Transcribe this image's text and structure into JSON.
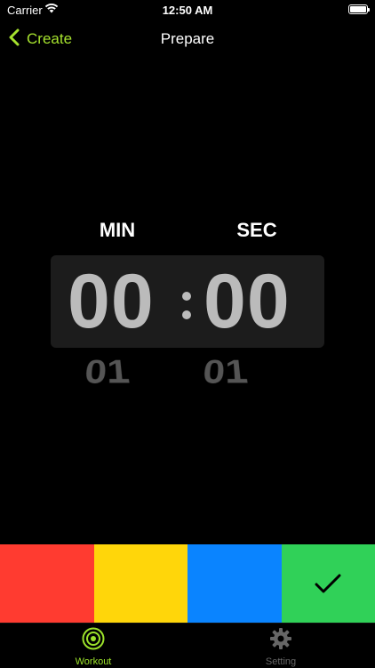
{
  "status_bar": {
    "carrier": "Carrier",
    "time": "12:50 AM"
  },
  "nav": {
    "back_label": "Create",
    "title": "Prepare"
  },
  "timer": {
    "min_label": "MIN",
    "sec_label": "SEC",
    "minutes": "00",
    "seconds": "00",
    "next_minutes": "01",
    "next_seconds": "01"
  },
  "colors": {
    "accent": "#a6e22e",
    "red": "#ff3b30",
    "yellow": "#ffd60a",
    "blue": "#0a84ff",
    "green": "#30d158"
  },
  "tabs": [
    {
      "label": "Workout",
      "icon": "target-icon",
      "selected": true
    },
    {
      "label": "Setting",
      "icon": "gear-icon",
      "selected": false
    }
  ]
}
